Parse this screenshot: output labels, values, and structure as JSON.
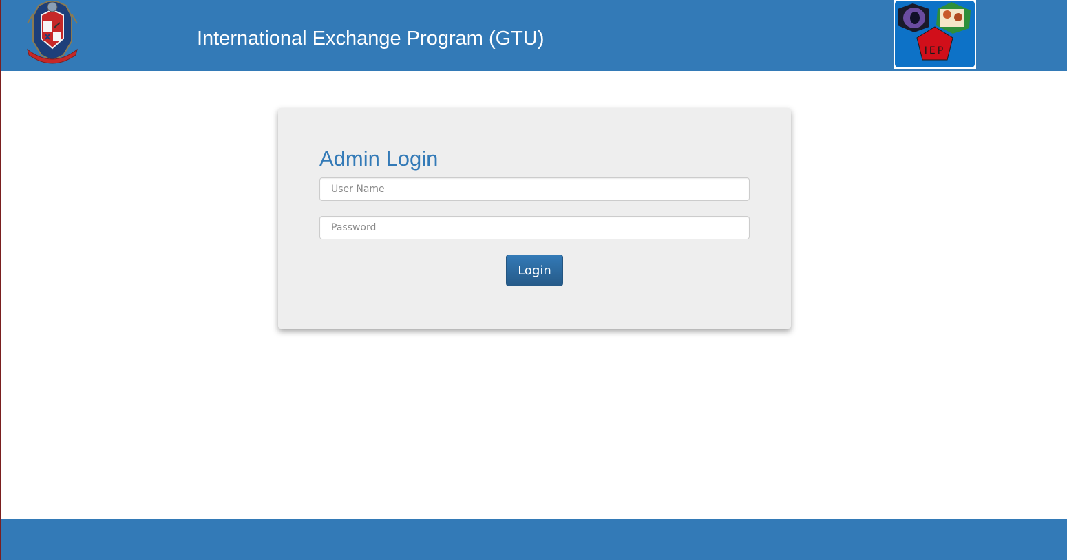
{
  "header": {
    "title": "International Exchange Program (GTU)",
    "gtu_logo_icon": "gtu-crest-logo",
    "iep_logo_icon": "iep-pentagon-logo",
    "iep_logo_text": "IEP"
  },
  "login": {
    "title": "Admin Login",
    "username_placeholder": "User Name",
    "username_value": "",
    "password_placeholder": "Password",
    "password_value": "",
    "submit_label": "Login"
  },
  "colors": {
    "brand_blue": "#337ab7",
    "card_background": "#eeeeee",
    "button_dark_blue": "#265a88"
  }
}
